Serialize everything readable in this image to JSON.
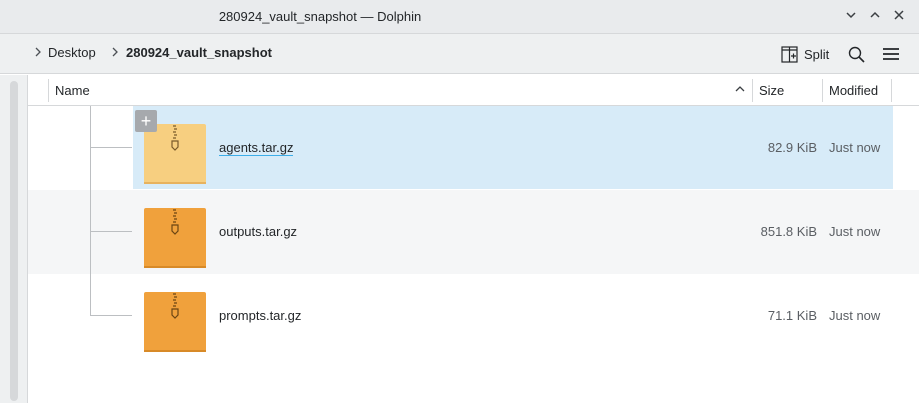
{
  "window": {
    "title": "280924_vault_snapshot — Dolphin"
  },
  "breadcrumb": {
    "items": [
      "Desktop",
      "280924_vault_snapshot"
    ]
  },
  "toolbar": {
    "split_label": "Split"
  },
  "columns": {
    "name": "Name",
    "size": "Size",
    "modified": "Modified"
  },
  "files": [
    {
      "name": "agents.tar.gz",
      "size": "82.9 KiB",
      "modified": "Just now",
      "selected": true
    },
    {
      "name": "outputs.tar.gz",
      "size": "851.8 KiB",
      "modified": "Just now",
      "selected": false
    },
    {
      "name": "prompts.tar.gz",
      "size": "71.1 KiB",
      "modified": "Just now",
      "selected": false
    }
  ],
  "colors": {
    "selection": "#d7ebf8",
    "archive_icon": "#f0a13c",
    "archive_icon_selected": "#f7cf80"
  }
}
